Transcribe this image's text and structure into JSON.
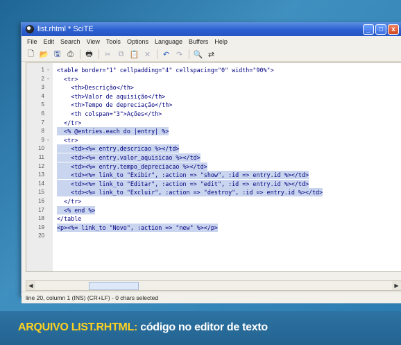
{
  "window": {
    "title": "list.rhtml * SciTE",
    "buttons": [
      "_",
      "□",
      "x"
    ]
  },
  "menu": [
    "File",
    "Edit",
    "Search",
    "View",
    "Tools",
    "Options",
    "Language",
    "Buffers",
    "Help"
  ],
  "toolbar": {
    "icons": [
      "new-file-icon",
      "open-icon",
      "save-icon",
      "print-preview-icon",
      "print-icon",
      "cut-icon",
      "copy-icon",
      "paste-icon",
      "delete-icon",
      "undo-icon",
      "redo-icon",
      "find-icon",
      "replace-icon"
    ]
  },
  "code_lines": [
    {
      "n": "1",
      "fold": "-",
      "text": "<table border=\"1\" cellpadding=\"4\" cellspacing=\"0\" width=\"90%\">"
    },
    {
      "n": "2",
      "fold": "-",
      "text": "  <tr>"
    },
    {
      "n": "3",
      "fold": "",
      "text": "    <th>Descrição</th>"
    },
    {
      "n": "4",
      "fold": "",
      "text": "    <th>Valor de aquisição</th>"
    },
    {
      "n": "5",
      "fold": "",
      "text": "    <th>Tempo de depreciação</th>"
    },
    {
      "n": "6",
      "fold": "",
      "text": "    <th colspan=\"3\">Ações</th>"
    },
    {
      "n": "7",
      "fold": "",
      "text": "  </tr>"
    },
    {
      "n": "8",
      "fold": "",
      "text": "  <% @entries.each do |entry| %>"
    },
    {
      "n": "9",
      "fold": "-",
      "text": "  <tr>"
    },
    {
      "n": "10",
      "fold": "",
      "text": "    <td><%= entry.descricao %></td>"
    },
    {
      "n": "11",
      "fold": "",
      "text": "    <td><%= entry.valor_aquisicao %></td>"
    },
    {
      "n": "12",
      "fold": "",
      "text": "    <td><%= entry.tempo_depreciacao %></td>"
    },
    {
      "n": "13",
      "fold": "",
      "text": "    <td><%= link_to \"Exibir\", :action => \"show\", :id => entry.id %></td>"
    },
    {
      "n": "14",
      "fold": "",
      "text": "    <td><%= link_to \"Editar\", :action => \"edit\", :id => entry.id %></td>"
    },
    {
      "n": "15",
      "fold": "",
      "text": "    <td><%= link_to \"Excluir\", :action => \"destroy\", :id => entry.id %></td>"
    },
    {
      "n": "16",
      "fold": "",
      "text": "  </tr>"
    },
    {
      "n": "17",
      "fold": "",
      "text": "  <% end %>"
    },
    {
      "n": "18",
      "fold": "",
      "text": "</table"
    },
    {
      "n": "19",
      "fold": "",
      "text": "<p><%= link_to \"Novo\", :action => \"new\" %></p>"
    },
    {
      "n": "20",
      "fold": "",
      "text": ""
    }
  ],
  "statusbar": "line 20, column 1 (INS) (CR+LF) - 0 chars selected",
  "caption": {
    "lead": "ARQUIVO LIST.RHTML:",
    "rest": " código no editor de texto"
  }
}
